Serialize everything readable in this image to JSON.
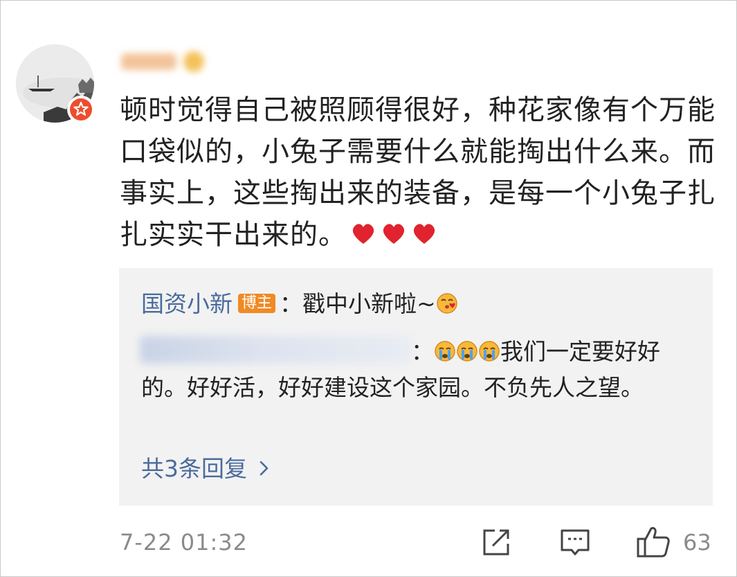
{
  "comment": {
    "text": "顿时觉得自己被照顾得很好，种花家像有个万能口袋似的，小兔子需要什么就能掏出什么来。而事实上，这些掏出来的装备，是每一个小兔子扎扎实实干出来的。",
    "emoji_trailing": [
      "heart",
      "heart",
      "heart"
    ],
    "timestamp": "7-22 01:32",
    "like_count": "63"
  },
  "reply_box": {
    "blogger_reply": {
      "name": "国资小新",
      "badge": "博主",
      "separator": "：",
      "text": "戳中小新啦~",
      "emoji": "kiss-face"
    },
    "second_reply": {
      "separator": "：",
      "emoji": [
        "crying-face",
        "crying-face",
        "crying-face"
      ],
      "text": "我们一定要好好的。好好活，好好建设这个家园。不负先人之望。"
    },
    "more_replies": "共3条回复"
  },
  "colors": {
    "link": "#4a6b9c",
    "badge_orange": "#f08a24",
    "verified_red": "#ee4d2d",
    "heart_red": "#e0232e",
    "reply_bg": "#f2f2f2",
    "muted_text": "#8a8a8a"
  },
  "icons": [
    "share-icon",
    "comment-icon",
    "like-icon",
    "chevron-right-icon",
    "verified-icon"
  ]
}
